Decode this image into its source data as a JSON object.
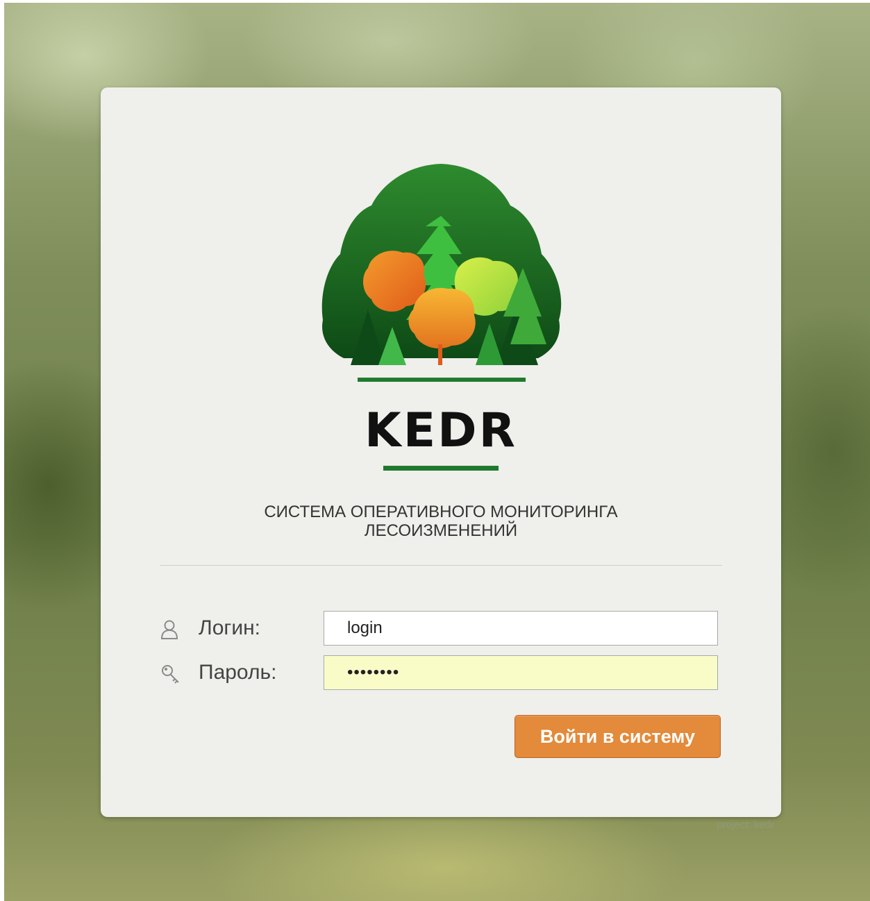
{
  "brand": {
    "name": "KEDR",
    "accent_green": "#1f7a2e"
  },
  "title": {
    "line1": "СИСТЕМА ОПЕРАТИВНОГО МОНИТОРИНГА",
    "line2": "ЛЕСОИЗМЕНЕНИЙ"
  },
  "form": {
    "login": {
      "label": "Логин:",
      "value": "login",
      "icon": "user-icon"
    },
    "password": {
      "label": "Пароль:",
      "value": "••••••••",
      "icon": "key-icon",
      "autofill_color": "#fafcc8"
    },
    "submit_label": "Войти в систему",
    "submit_color": "#e38a3b"
  },
  "footer": {
    "project": "project: kedr"
  }
}
